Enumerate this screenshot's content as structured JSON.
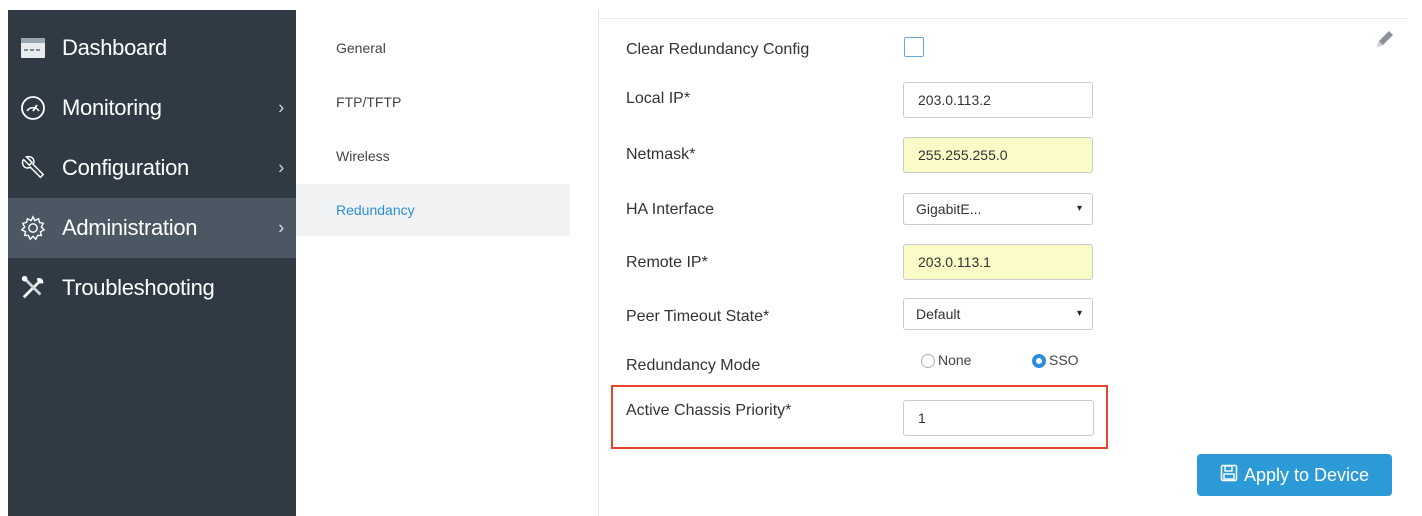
{
  "sidebar": {
    "items": [
      {
        "label": "Dashboard",
        "icon": "dashboard-icon",
        "has_chevron": false
      },
      {
        "label": "Monitoring",
        "icon": "gauge-icon",
        "has_chevron": true,
        "chevron": "›"
      },
      {
        "label": "Configuration",
        "icon": "wrench-icon",
        "has_chevron": true,
        "chevron": "›"
      },
      {
        "label": "Administration",
        "icon": "gear-icon",
        "has_chevron": true,
        "chevron": "›",
        "active": true
      },
      {
        "label": "Troubleshooting",
        "icon": "tools-icon",
        "has_chevron": false
      }
    ]
  },
  "subnav": {
    "items": [
      {
        "label": "General"
      },
      {
        "label": "FTP/TFTP"
      },
      {
        "label": "Wireless"
      },
      {
        "label": "Redundancy",
        "active": true
      }
    ]
  },
  "form": {
    "clear_redundancy_label": "Clear Redundancy Config",
    "clear_redundancy_checked": false,
    "local_ip_label": "Local IP*",
    "local_ip_value": "203.0.113.2",
    "netmask_label": "Netmask*",
    "netmask_value": "255.255.255.0",
    "ha_interface_label": "HA Interface",
    "ha_interface_value": "GigabitE...",
    "remote_ip_label": "Remote IP*",
    "remote_ip_value": "203.0.113.1",
    "peer_timeout_label": "Peer Timeout State*",
    "peer_timeout_value": "Default",
    "redundancy_mode_label": "Redundancy Mode",
    "redundancy_mode_options": [
      "None",
      "SSO"
    ],
    "redundancy_mode_selected": "SSO",
    "active_chassis_label": "Active Chassis Priority*",
    "active_chassis_value": "1",
    "caret": "▾"
  },
  "actions": {
    "apply_label": "Apply to Device",
    "edit_icon": "pencil-icon"
  },
  "colors": {
    "sidebar_bg": "#2f3a44",
    "sidebar_active": "#4b5864",
    "accent": "#2d9ad8",
    "required_field": "#fbfbc8",
    "highlight": "#e6452e"
  }
}
